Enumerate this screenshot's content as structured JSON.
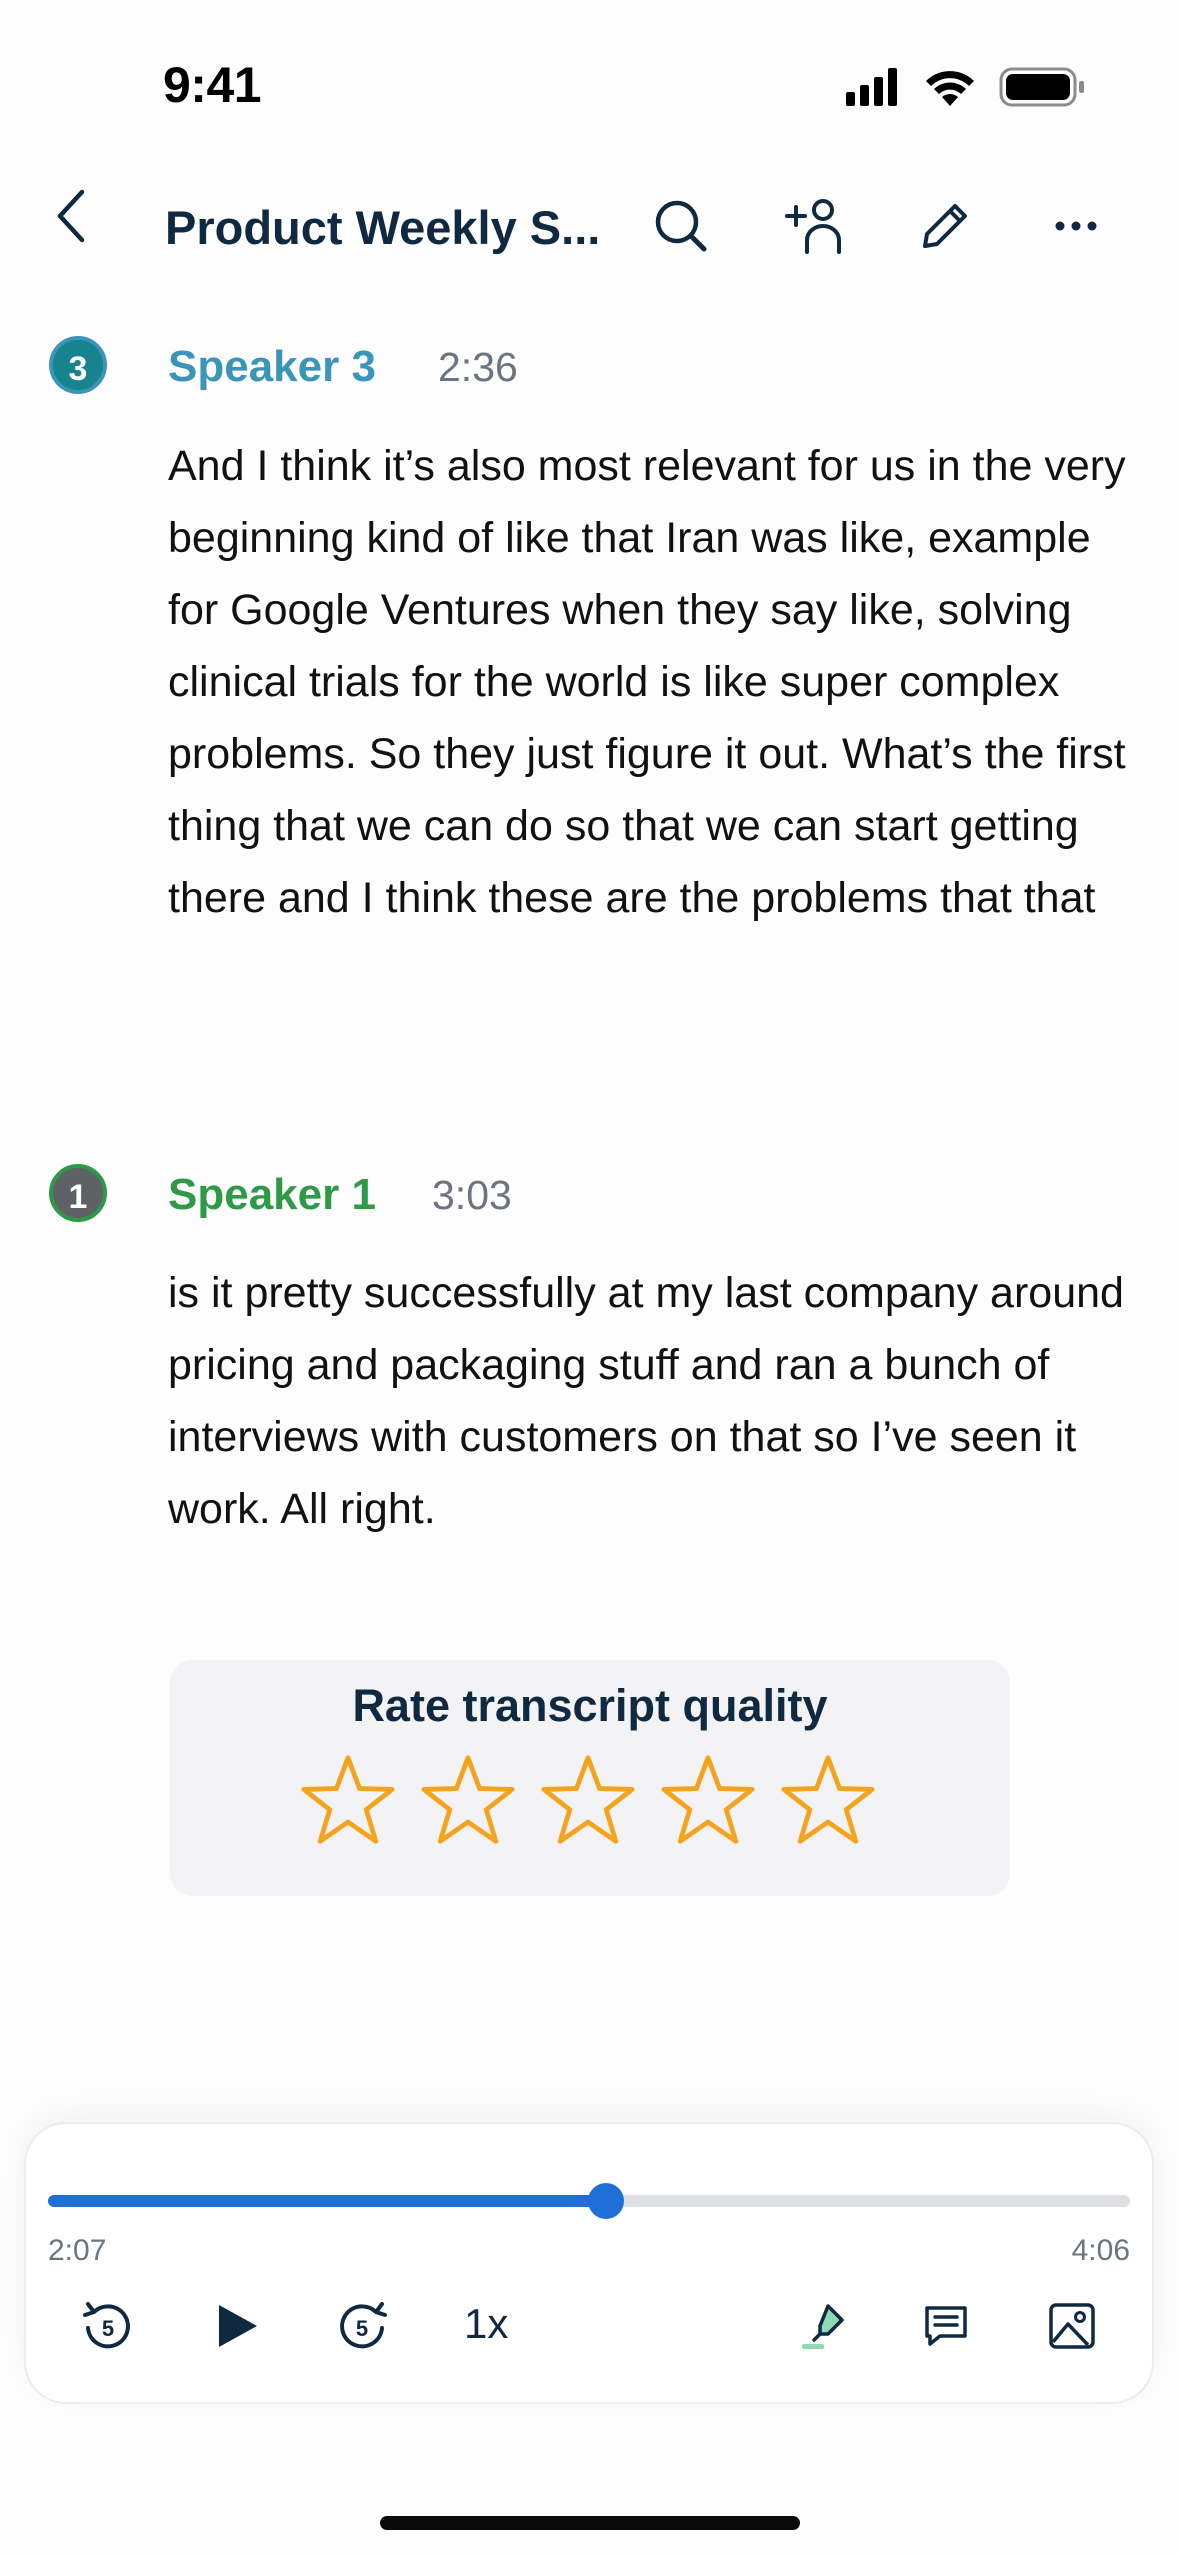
{
  "status": {
    "time": "9:41"
  },
  "header": {
    "title": "Product Weekly S..."
  },
  "segments": [
    {
      "badge": "3",
      "speaker": "Speaker 3",
      "timestamp": "2:36",
      "color": "#3a95b8",
      "text": "And I think it’s also most relevant for us in the very beginning kind of like that Iran was like, example for Google Ventures when they say like, solving clinical trials for the world is like super complex problems. So they just figure it out. What’s the first thing that we can do so that we can start getting there and I think these are the problems that that"
    },
    {
      "badge": "1",
      "speaker": "Speaker 1",
      "timestamp": "3:03",
      "color": "#2e9a47",
      "text": "is it pretty successfully at my last company around pricing and packaging stuff and ran a bunch of interviews with customers on that so I’ve seen it work. All right."
    }
  ],
  "rating": {
    "title": "Rate transcript quality",
    "max": 5,
    "value": 0,
    "star_color": "#f4a31c"
  },
  "player": {
    "current": "2:07",
    "duration": "4:06",
    "progress": 0.516,
    "speed": "1x",
    "accent": "#1f6fd6"
  },
  "icons": [
    "chevron-left-icon",
    "search-icon",
    "add-person-icon",
    "pencil-icon",
    "more-icon",
    "rewind-5-icon",
    "play-icon",
    "forward-5-icon",
    "highlighter-icon",
    "comment-icon",
    "image-icon"
  ]
}
